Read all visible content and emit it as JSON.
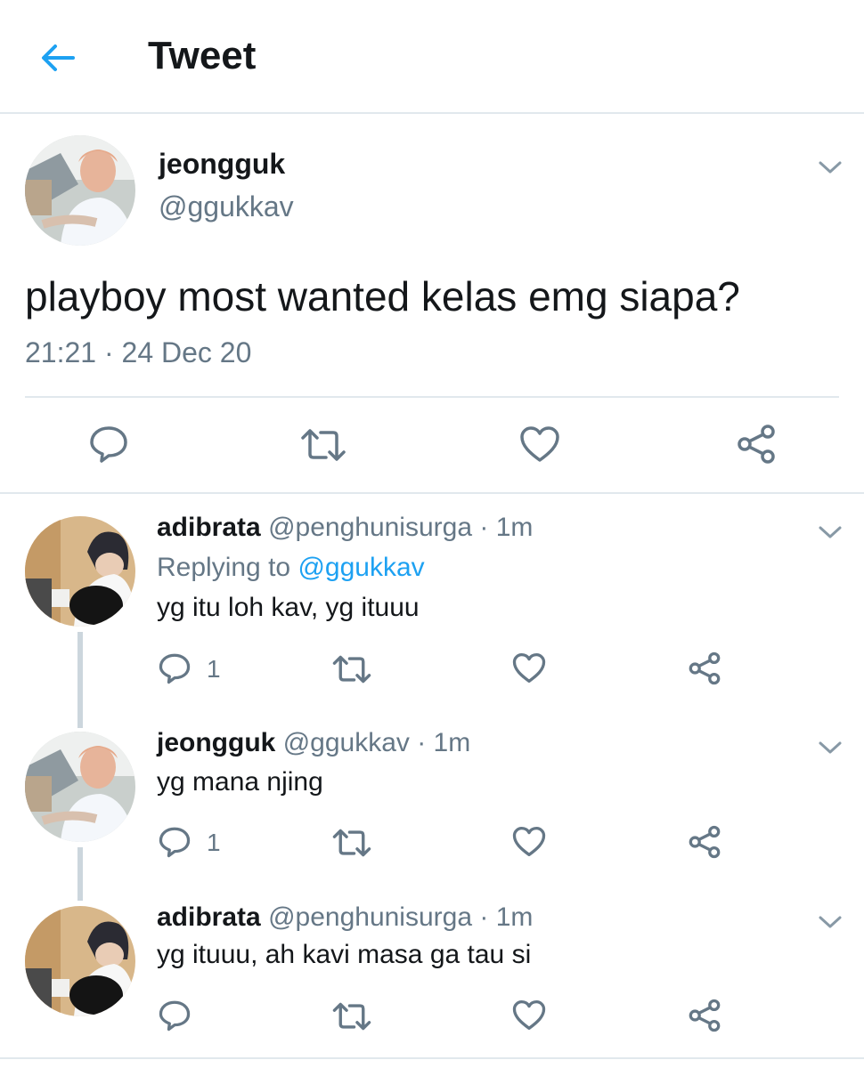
{
  "header": {
    "title": "Tweet"
  },
  "tweet": {
    "name": "jeongguk",
    "handle": "@ggukkav",
    "text": "playboy most wanted kelas emg siapa?",
    "meta": "21:21 · 24 Dec 20"
  },
  "replies": [
    {
      "name": "adibrata",
      "handle": "@penghunisurga",
      "time": "· 1m",
      "replying_prefix": "Replying to ",
      "replying_to": "@ggukkav",
      "text": "yg itu loh kav, yg ituuu",
      "reply_count": "1"
    },
    {
      "name": "jeongguk",
      "handle": "@ggukkav",
      "time": "· 1m",
      "text": "yg mana njing",
      "reply_count": "1"
    },
    {
      "name": "adibrata",
      "handle": "@penghunisurga",
      "time": "· 1m",
      "text": "yg ituuu, ah kavi masa ga tau si",
      "reply_count": ""
    }
  ],
  "colors": {
    "accent": "#1da1f2",
    "icon": "#657786",
    "divider": "#e1e8ed",
    "thread": "#ccd6dd"
  },
  "icons": [
    "back-arrow-icon",
    "chevron-down-icon",
    "reply-icon",
    "retweet-icon",
    "like-icon",
    "share-icon"
  ]
}
